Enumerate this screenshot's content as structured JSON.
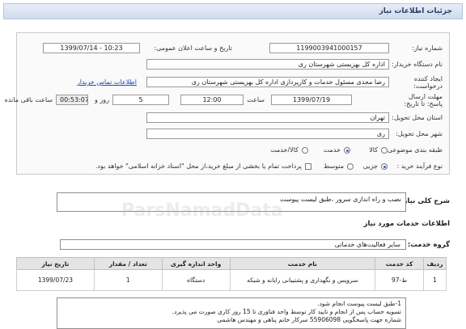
{
  "header": {
    "title": "جزئیات اطلاعات نیاز"
  },
  "form": {
    "need_number_label": "شماره نیاز:",
    "need_number": "1199003941000157",
    "announce_label": "تاریخ و ساعت اعلان عمومی:",
    "announce_value": "1399/07/14 - 10:23",
    "buyer_label": "نام دستگاه خریدار:",
    "buyer_value": "اداره کل بهزیستی شهرستان ری",
    "creator_label": "ایجاد کننده درخواست:",
    "creator_value": "رضا مجدی مسئول خدمات و کارپردازی اداره کل بهزیستی شهرستان ری",
    "contact_link": "اطلاعات تماس خریدار",
    "deadline_label": "مهلت ارسال پاسخ: تا تاریخ:",
    "deadline_date": "1399/07/19",
    "time_label": "ساعت",
    "deadline_time": "12:00",
    "days_value": "5",
    "days_label": "روز و",
    "remaining_time": "00:53:07",
    "remaining_label": "ساعت باقی مانده",
    "province_label": "استان محل تحویل:",
    "province_value": "تهران",
    "city_label": "شهر محل تحویل:",
    "city_value": "ری",
    "category_label": "طبقه بندی موضوعی:",
    "category_options": [
      "کالا",
      "خدمت",
      "کالا/خدمت"
    ],
    "process_label": "نوع فرآیند خرید :",
    "process_options": [
      "جزیی",
      "متوسط"
    ],
    "payment_note": "پرداخت تمام یا بخشی از مبلغ خرید،از محل \"اسناد خزانه اسلامی\" خواهد بود."
  },
  "summary": {
    "label": "شرح کلی نیاز:",
    "value": "نصب و راه اندازی سرور ،طبق لیست پیوست"
  },
  "services": {
    "title": "اطلاعات خدمات مورد نیاز",
    "group_label": "گروه خدمت:",
    "group_value": "سایر فعالیت‌های خدماتی",
    "columns": [
      "ردیف",
      "کد خدمت",
      "نام خدمت",
      "واحد اندازه گیری",
      "تعداد / مقدار",
      "تاریخ نیاز"
    ],
    "rows": [
      [
        "1",
        "ط-97",
        "سرویس و نگهداری و پشتیبانی رایانه و شبکه",
        "دستگاه",
        "1",
        "1399/07/23"
      ]
    ]
  },
  "notes": {
    "lines": [
      "1-طبق لیست پیوست انجام شود.",
      "تسویه حساب پس از انجام و تایید کار توسط واحد فناوری تا 15 روز کاری صورت می پذیرد.",
      "شماره جهت پاسخگویی 55906098 سرکار خانم پناهی و مهندس هاشمی"
    ]
  },
  "watermark": "ParsNamadData"
}
